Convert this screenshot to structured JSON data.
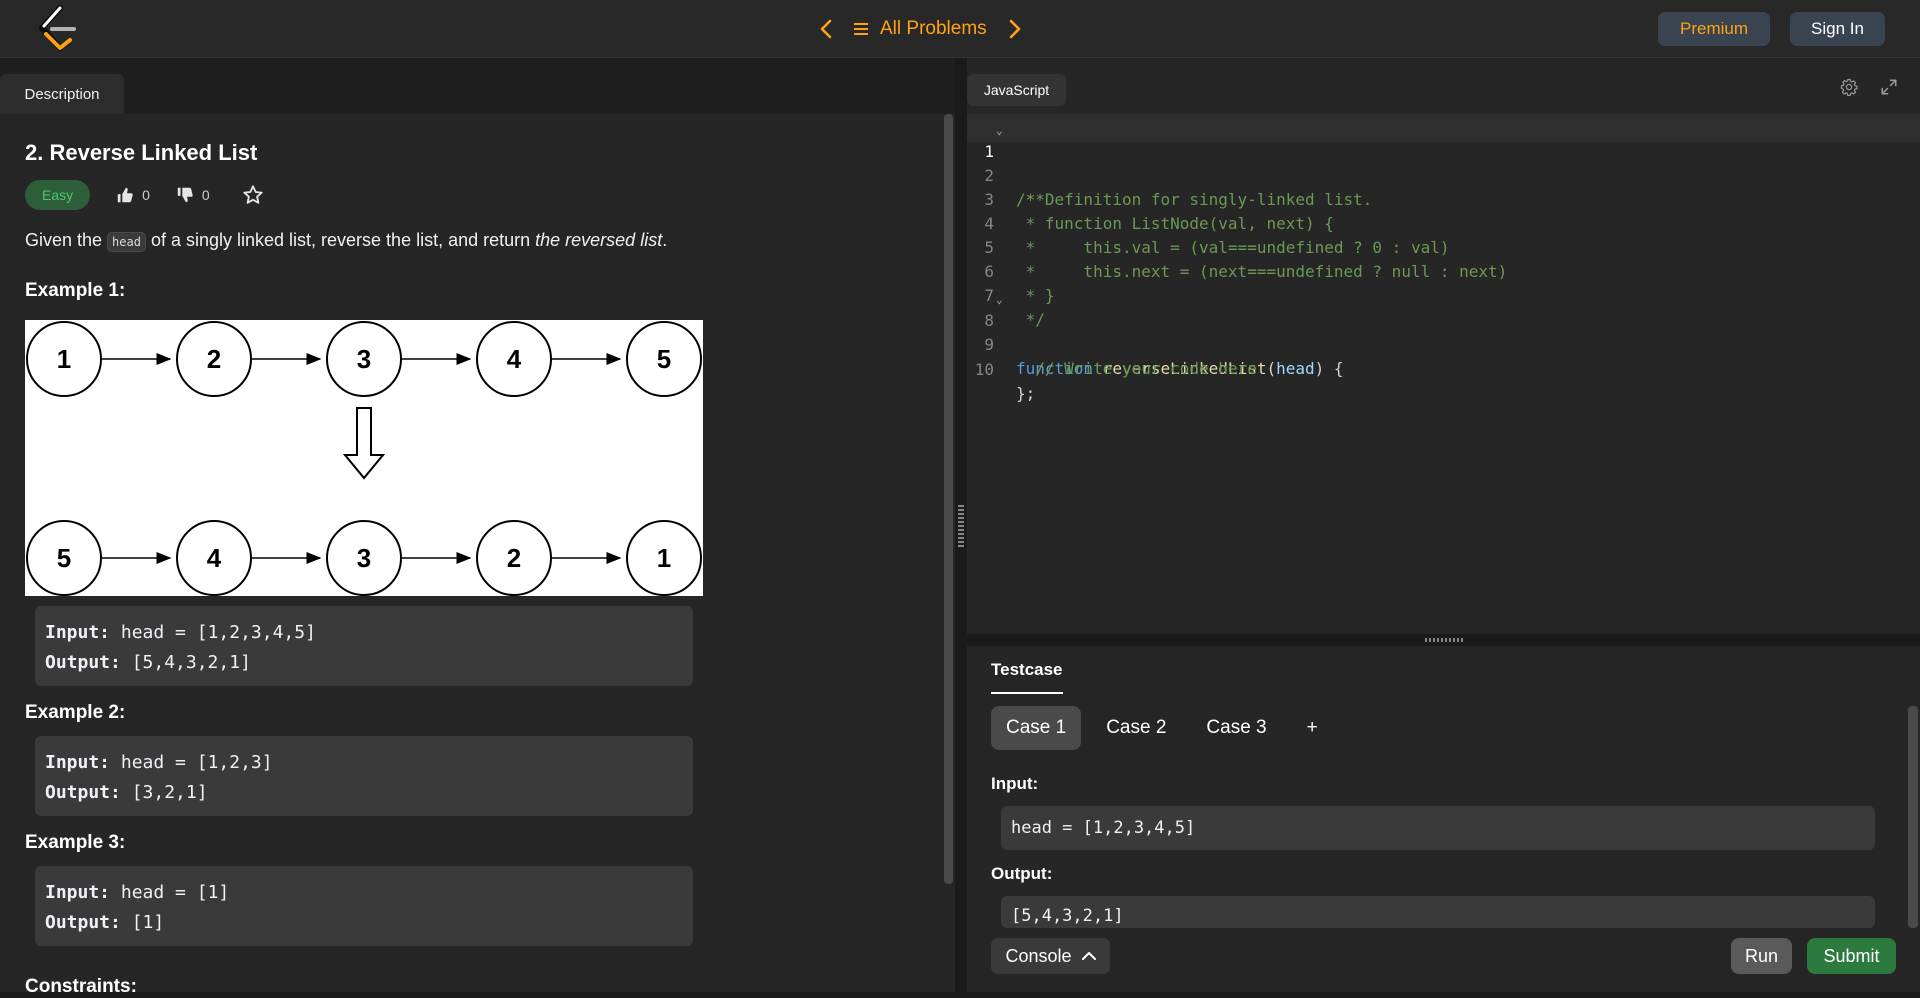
{
  "nav": {
    "title": "All Problems",
    "premium": "Premium",
    "sign_in": "Sign In"
  },
  "left": {
    "tab": "Description",
    "problem_title": "2. Reverse Linked List",
    "difficulty": "Easy",
    "likes": "0",
    "dislikes": "0",
    "desc": {
      "before": "Given the ",
      "code": "head",
      "middle": " of a singly linked list, reverse the list, and return ",
      "em": "the reversed list",
      "after": "."
    },
    "diagram": {
      "top_nodes": [
        "1",
        "2",
        "3",
        "4",
        "5"
      ],
      "bottom_nodes": [
        "5",
        "4",
        "3",
        "2",
        "1"
      ]
    },
    "examples": [
      {
        "heading": "Example 1:",
        "input_label": "Input:",
        "input": " head = [1,2,3,4,5]",
        "output_label": "Output:",
        "output": " [5,4,3,2,1]"
      },
      {
        "heading": "Example 2:",
        "input_label": "Input:",
        "input": " head = [1,2,3]",
        "output_label": "Output:",
        "output": " [3,2,1]"
      },
      {
        "heading": "Example 3:",
        "input_label": "Input:",
        "input": " head = [1]",
        "output_label": "Output:",
        "output": " [1]"
      }
    ],
    "constraints": "Constraints:"
  },
  "editor": {
    "language": "JavaScript",
    "lines": [
      {
        "n": "1",
        "text": "/**"
      },
      {
        "n": "2",
        "text": " * Definition for singly-linked list."
      },
      {
        "n": "3",
        "text": " * function ListNode(val, next) {"
      },
      {
        "n": "4",
        "text": " *     this.val = (val===undefined ? 0 : val)"
      },
      {
        "n": "5",
        "text": " *     this.next = (next===undefined ? null : next)"
      },
      {
        "n": "6",
        "text": " * }"
      },
      {
        "n": "7",
        "text": " */"
      },
      {
        "n": "8",
        "kw": "function",
        "fn": "reverseLinkedList",
        "param": "head",
        "open": "(",
        "close": ") {"
      },
      {
        "n": "9",
        "text": "  // Write your code here"
      },
      {
        "n": "10",
        "text": "};"
      }
    ]
  },
  "testcase": {
    "tab": "Testcase",
    "cases": [
      "Case 1",
      "Case 2",
      "Case 3",
      "+"
    ],
    "input_label": "Input:",
    "input_value": "head = [1,2,3,4,5]",
    "output_label": "Output:",
    "output_value": "[5,4,3,2,1]"
  },
  "actions": {
    "console": "Console",
    "run": "Run",
    "submit": "Submit"
  },
  "colors": {
    "accent": "#ffa116",
    "easy": "#4ec76d",
    "submit": "#2c7a3e"
  }
}
